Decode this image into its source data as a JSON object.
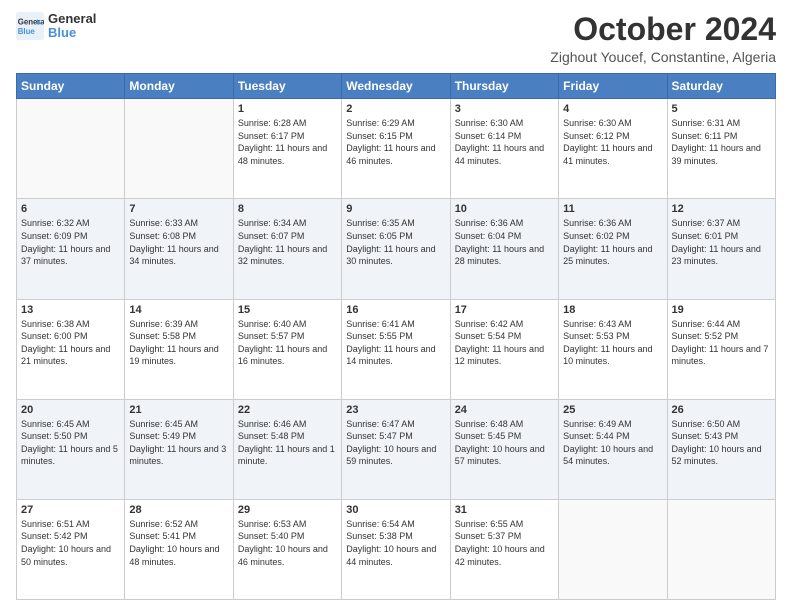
{
  "header": {
    "logo_line1": "General",
    "logo_line2": "Blue",
    "month_title": "October 2024",
    "location": "Zighout Youcef, Constantine, Algeria"
  },
  "days_of_week": [
    "Sunday",
    "Monday",
    "Tuesday",
    "Wednesday",
    "Thursday",
    "Friday",
    "Saturday"
  ],
  "weeks": [
    [
      {
        "day": "",
        "sunrise": "",
        "sunset": "",
        "daylight": ""
      },
      {
        "day": "",
        "sunrise": "",
        "sunset": "",
        "daylight": ""
      },
      {
        "day": "1",
        "sunrise": "Sunrise: 6:28 AM",
        "sunset": "Sunset: 6:17 PM",
        "daylight": "Daylight: 11 hours and 48 minutes."
      },
      {
        "day": "2",
        "sunrise": "Sunrise: 6:29 AM",
        "sunset": "Sunset: 6:15 PM",
        "daylight": "Daylight: 11 hours and 46 minutes."
      },
      {
        "day": "3",
        "sunrise": "Sunrise: 6:30 AM",
        "sunset": "Sunset: 6:14 PM",
        "daylight": "Daylight: 11 hours and 44 minutes."
      },
      {
        "day": "4",
        "sunrise": "Sunrise: 6:30 AM",
        "sunset": "Sunset: 6:12 PM",
        "daylight": "Daylight: 11 hours and 41 minutes."
      },
      {
        "day": "5",
        "sunrise": "Sunrise: 6:31 AM",
        "sunset": "Sunset: 6:11 PM",
        "daylight": "Daylight: 11 hours and 39 minutes."
      }
    ],
    [
      {
        "day": "6",
        "sunrise": "Sunrise: 6:32 AM",
        "sunset": "Sunset: 6:09 PM",
        "daylight": "Daylight: 11 hours and 37 minutes."
      },
      {
        "day": "7",
        "sunrise": "Sunrise: 6:33 AM",
        "sunset": "Sunset: 6:08 PM",
        "daylight": "Daylight: 11 hours and 34 minutes."
      },
      {
        "day": "8",
        "sunrise": "Sunrise: 6:34 AM",
        "sunset": "Sunset: 6:07 PM",
        "daylight": "Daylight: 11 hours and 32 minutes."
      },
      {
        "day": "9",
        "sunrise": "Sunrise: 6:35 AM",
        "sunset": "Sunset: 6:05 PM",
        "daylight": "Daylight: 11 hours and 30 minutes."
      },
      {
        "day": "10",
        "sunrise": "Sunrise: 6:36 AM",
        "sunset": "Sunset: 6:04 PM",
        "daylight": "Daylight: 11 hours and 28 minutes."
      },
      {
        "day": "11",
        "sunrise": "Sunrise: 6:36 AM",
        "sunset": "Sunset: 6:02 PM",
        "daylight": "Daylight: 11 hours and 25 minutes."
      },
      {
        "day": "12",
        "sunrise": "Sunrise: 6:37 AM",
        "sunset": "Sunset: 6:01 PM",
        "daylight": "Daylight: 11 hours and 23 minutes."
      }
    ],
    [
      {
        "day": "13",
        "sunrise": "Sunrise: 6:38 AM",
        "sunset": "Sunset: 6:00 PM",
        "daylight": "Daylight: 11 hours and 21 minutes."
      },
      {
        "day": "14",
        "sunrise": "Sunrise: 6:39 AM",
        "sunset": "Sunset: 5:58 PM",
        "daylight": "Daylight: 11 hours and 19 minutes."
      },
      {
        "day": "15",
        "sunrise": "Sunrise: 6:40 AM",
        "sunset": "Sunset: 5:57 PM",
        "daylight": "Daylight: 11 hours and 16 minutes."
      },
      {
        "day": "16",
        "sunrise": "Sunrise: 6:41 AM",
        "sunset": "Sunset: 5:55 PM",
        "daylight": "Daylight: 11 hours and 14 minutes."
      },
      {
        "day": "17",
        "sunrise": "Sunrise: 6:42 AM",
        "sunset": "Sunset: 5:54 PM",
        "daylight": "Daylight: 11 hours and 12 minutes."
      },
      {
        "day": "18",
        "sunrise": "Sunrise: 6:43 AM",
        "sunset": "Sunset: 5:53 PM",
        "daylight": "Daylight: 11 hours and 10 minutes."
      },
      {
        "day": "19",
        "sunrise": "Sunrise: 6:44 AM",
        "sunset": "Sunset: 5:52 PM",
        "daylight": "Daylight: 11 hours and 7 minutes."
      }
    ],
    [
      {
        "day": "20",
        "sunrise": "Sunrise: 6:45 AM",
        "sunset": "Sunset: 5:50 PM",
        "daylight": "Daylight: 11 hours and 5 minutes."
      },
      {
        "day": "21",
        "sunrise": "Sunrise: 6:45 AM",
        "sunset": "Sunset: 5:49 PM",
        "daylight": "Daylight: 11 hours and 3 minutes."
      },
      {
        "day": "22",
        "sunrise": "Sunrise: 6:46 AM",
        "sunset": "Sunset: 5:48 PM",
        "daylight": "Daylight: 11 hours and 1 minute."
      },
      {
        "day": "23",
        "sunrise": "Sunrise: 6:47 AM",
        "sunset": "Sunset: 5:47 PM",
        "daylight": "Daylight: 10 hours and 59 minutes."
      },
      {
        "day": "24",
        "sunrise": "Sunrise: 6:48 AM",
        "sunset": "Sunset: 5:45 PM",
        "daylight": "Daylight: 10 hours and 57 minutes."
      },
      {
        "day": "25",
        "sunrise": "Sunrise: 6:49 AM",
        "sunset": "Sunset: 5:44 PM",
        "daylight": "Daylight: 10 hours and 54 minutes."
      },
      {
        "day": "26",
        "sunrise": "Sunrise: 6:50 AM",
        "sunset": "Sunset: 5:43 PM",
        "daylight": "Daylight: 10 hours and 52 minutes."
      }
    ],
    [
      {
        "day": "27",
        "sunrise": "Sunrise: 6:51 AM",
        "sunset": "Sunset: 5:42 PM",
        "daylight": "Daylight: 10 hours and 50 minutes."
      },
      {
        "day": "28",
        "sunrise": "Sunrise: 6:52 AM",
        "sunset": "Sunset: 5:41 PM",
        "daylight": "Daylight: 10 hours and 48 minutes."
      },
      {
        "day": "29",
        "sunrise": "Sunrise: 6:53 AM",
        "sunset": "Sunset: 5:40 PM",
        "daylight": "Daylight: 10 hours and 46 minutes."
      },
      {
        "day": "30",
        "sunrise": "Sunrise: 6:54 AM",
        "sunset": "Sunset: 5:38 PM",
        "daylight": "Daylight: 10 hours and 44 minutes."
      },
      {
        "day": "31",
        "sunrise": "Sunrise: 6:55 AM",
        "sunset": "Sunset: 5:37 PM",
        "daylight": "Daylight: 10 hours and 42 minutes."
      },
      {
        "day": "",
        "sunrise": "",
        "sunset": "",
        "daylight": ""
      },
      {
        "day": "",
        "sunrise": "",
        "sunset": "",
        "daylight": ""
      }
    ]
  ]
}
